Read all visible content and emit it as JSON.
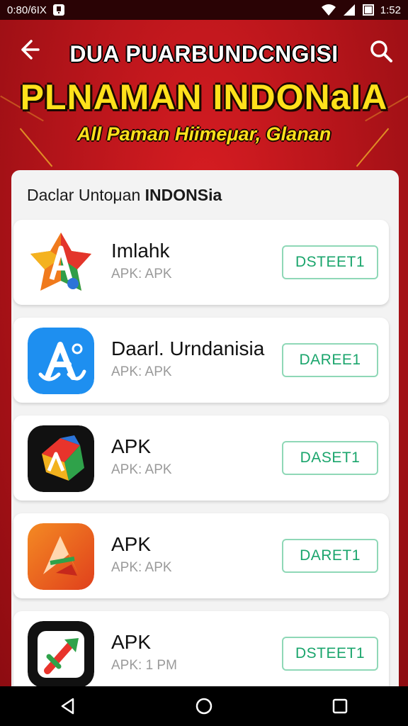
{
  "status_bar": {
    "left_text": "0:80/6IX",
    "time": "1:52"
  },
  "header": {
    "title_line1": "DUA PUARBUNDCNGISI",
    "title_line2": "PLNAMAN INDONaIA",
    "title_line3": "All Paman Hiimeμar, Glanan"
  },
  "panel": {
    "title_prefix": "Daclar Untoμan ",
    "title_bold": "INDONSia",
    "apps": [
      {
        "name": "Imlahk",
        "sub": "APK: APK",
        "button": "DSTEET1",
        "icon": "orange-star-a-icon"
      },
      {
        "name": "Daarl. Urndanisia",
        "sub": "APK: APK",
        "button": "DAREE1",
        "icon": "blue-a-icon"
      },
      {
        "name": "APK",
        "sub": "APK: APK",
        "button": "DASET1",
        "icon": "colorful-cube-icon"
      },
      {
        "name": "APK",
        "sub": "APK: APK",
        "button": "DARET1",
        "icon": "orange-a-icon"
      },
      {
        "name": "APK",
        "sub": "APK: 1 PM",
        "button": "DSTEET1",
        "icon": "arrow-logo-icon"
      }
    ]
  },
  "colors": {
    "accent_red": "#c4171d",
    "title_yellow": "#ffe11b",
    "button_green": "#1aa56c"
  }
}
